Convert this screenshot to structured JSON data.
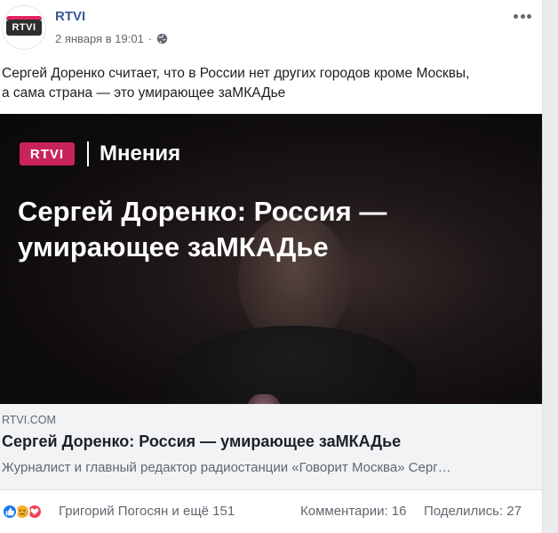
{
  "post": {
    "page_name": "RTVI",
    "avatar_label": "RTVI",
    "timestamp": "2 января в 19:01",
    "text_line1": "Сергей Доренко считает, что в России нет других городов кроме Москвы,",
    "text_line2": "а сама страна — это умирающее заМКАДье",
    "visibility_icon": "globe-icon",
    "more_icon": "more-options-icon"
  },
  "link_image": {
    "brand": "RTVI",
    "section": "Мнения",
    "headline_line1": "Сергей Доренко: Россия —",
    "headline_line2": "умирающее заМКАДье"
  },
  "link_preview": {
    "domain": "RTVI.COM",
    "title": "Сергей Доренко: Россия — умирающее заМКАДье",
    "description": "Журналист и главный редактор радиостанции «Говорит Москва» Серг…"
  },
  "footer": {
    "reaction_icons": [
      "like-icon",
      "sad-icon",
      "love-icon"
    ],
    "reactors": "Григорий Погосян и ещё 151",
    "comments": "Комментарии: 16",
    "shares": "Поделились: 27"
  },
  "colors": {
    "link_blue": "#385898",
    "brand_pink": "#c8245a",
    "like_blue": "#1877f2",
    "love_red": "#f33e58",
    "sad_yellow": "#f7b125"
  }
}
